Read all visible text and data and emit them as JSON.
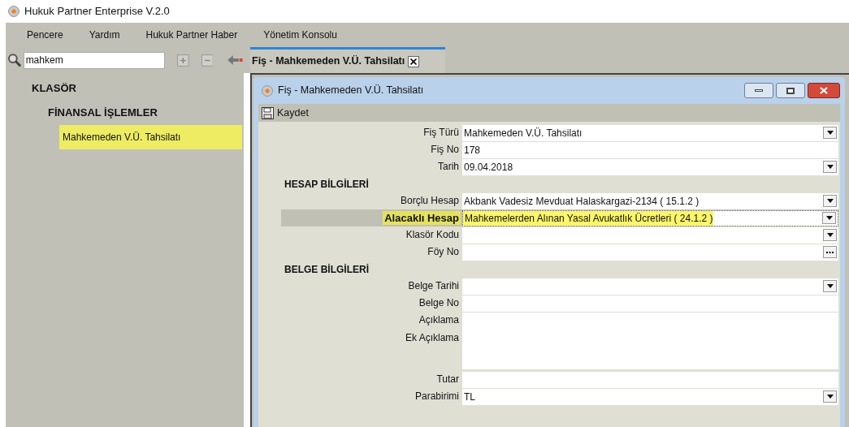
{
  "app_title": "Hukuk Partner Enterprise V.2.0",
  "menu": [
    "Pencere",
    "Yardım",
    "Hukuk Partner Haber",
    "Yönetim Konsolu"
  ],
  "search": {
    "value": "mahkem"
  },
  "tree": [
    {
      "label": "KLASÖR",
      "selected": false,
      "children": [
        {
          "label": "FİNANSAL İŞLEMLER",
          "selected": false,
          "children": [
            {
              "label": "Mahkemeden V.Ü. Tahsilatı",
              "selected": true
            }
          ]
        }
      ]
    }
  ],
  "tabs": [
    {
      "label": "Fiş - Mahkemeden V.Ü. Tahsilatı",
      "selected": true
    }
  ],
  "window": {
    "title": "Fiş - Mahkemeden V.Ü. Tahsilatı",
    "toolbar": [
      "Kaydet"
    ]
  },
  "form": [
    {
      "kind": "dropdown",
      "label": "Fiş Türü",
      "value": "Mahkemeden V.Ü. Tahsilatı",
      "highlighted": false
    },
    {
      "kind": "text",
      "label": "Fiş No",
      "value": "178",
      "highlighted": false
    },
    {
      "kind": "dropdown",
      "label": "Tarih",
      "value": "09.04.2018",
      "highlighted": false
    },
    {
      "kind": "section",
      "label": "HESAP BİLGİLERİ"
    },
    {
      "kind": "dropdown",
      "label": "Borçlu Hesap",
      "value": "Akbank Vadesiz Mevduat Halaskargazi-2134 ( 15.1.2 )",
      "highlighted": false
    },
    {
      "kind": "dropdown",
      "label": "Alacaklı Hesap",
      "value": "Mahkemelerden Alınan Yasal Avukatlık Ücretleri ( 24.1.2 )",
      "highlighted": true
    },
    {
      "kind": "dropdown",
      "label": "Klasör Kodu",
      "highlighted": false
    },
    {
      "kind": "ellipsis",
      "label": "Föy No",
      "highlighted": false
    },
    {
      "kind": "section",
      "label": "BELGE BİLGİLERİ"
    },
    {
      "kind": "dropdown",
      "label": "Belge Tarihi",
      "highlighted": false
    },
    {
      "kind": "text",
      "label": "Belge No",
      "highlighted": false
    },
    {
      "kind": "text",
      "label": "Açıklama",
      "highlighted": false
    },
    {
      "kind": "textarea",
      "label": "Ek Açıklama",
      "highlighted": false
    },
    {
      "kind": "text",
      "label": "Tutar",
      "highlighted": false
    },
    {
      "kind": "dropdown",
      "label": "Parabirimi",
      "value": "TL",
      "highlighted": false
    }
  ]
}
